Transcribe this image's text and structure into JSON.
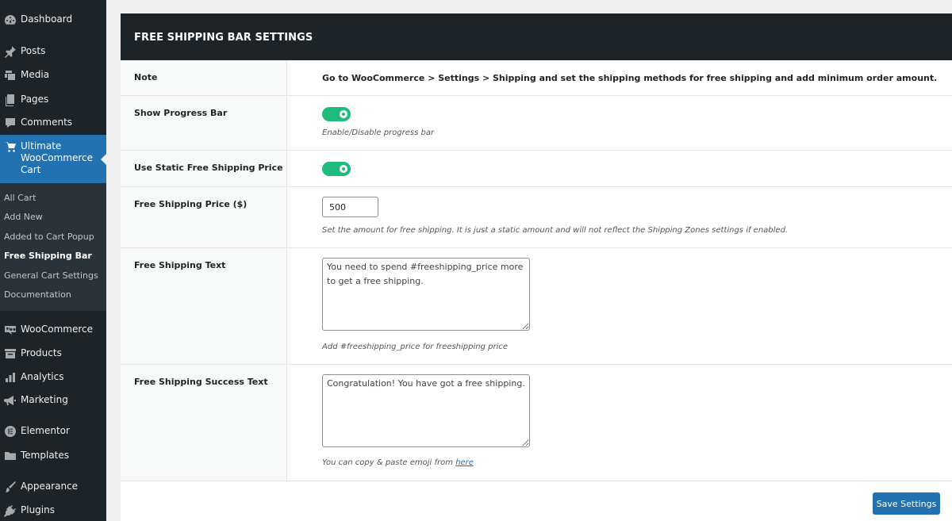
{
  "sidebar": {
    "items": [
      {
        "label": "Dashboard",
        "icon": "dashboard-icon"
      },
      {
        "label": "Posts",
        "icon": "pin-icon"
      },
      {
        "label": "Media",
        "icon": "media-icon"
      },
      {
        "label": "Pages",
        "icon": "pages-icon"
      },
      {
        "label": "Comments",
        "icon": "comment-icon"
      },
      {
        "label": "Ultimate WooCommerce Cart",
        "icon": "cart-icon",
        "active": true
      },
      {
        "label": "WooCommerce",
        "icon": "woocommerce-icon"
      },
      {
        "label": "Products",
        "icon": "products-icon"
      },
      {
        "label": "Analytics",
        "icon": "analytics-icon"
      },
      {
        "label": "Marketing",
        "icon": "megaphone-icon"
      },
      {
        "label": "Elementor",
        "icon": "elementor-icon"
      },
      {
        "label": "Templates",
        "icon": "folder-icon"
      },
      {
        "label": "Appearance",
        "icon": "brush-icon"
      },
      {
        "label": "Plugins",
        "icon": "plug-icon"
      }
    ],
    "submenu": [
      {
        "label": "All Cart"
      },
      {
        "label": "Add New"
      },
      {
        "label": "Added to Cart Popup"
      },
      {
        "label": "Free Shipping Bar",
        "current": true
      },
      {
        "label": "General Cart Settings"
      },
      {
        "label": "Documentation"
      }
    ]
  },
  "panel": {
    "title": "FREE SHIPPING BAR SETTINGS",
    "note": {
      "label": "Note",
      "text": "Go to WooCommerce > Settings > Shipping and set the shipping methods for free shipping and add minimum order amount."
    },
    "show_progress_bar": {
      "label": "Show Progress Bar",
      "enabled": true,
      "description": "Enable/Disable progress bar"
    },
    "use_static_price": {
      "label": "Use Static Free Shipping Price",
      "enabled": true
    },
    "price": {
      "label": "Free Shipping Price ($)",
      "value": "500",
      "description": "Set the amount for free shipping. It is just a static amount and will not reflect the Shipping Zones settings if enabled."
    },
    "shipping_text": {
      "label": "Free Shipping Text",
      "value": "You need to spend #freeshipping_price more to get a free shipping.",
      "description": "Add #freeshipping_price for freeshipping price"
    },
    "success_text": {
      "label": "Free Shipping Success Text",
      "value": "Congratulation! You have got a free shipping.",
      "description_prefix": "You can copy & paste emoji from",
      "description_link": "here"
    },
    "save_label": "Save Settings"
  },
  "colors": {
    "sidebar_bg": "#1d2327",
    "accent": "#2271b1",
    "toggle_on": "#21ba7d"
  }
}
